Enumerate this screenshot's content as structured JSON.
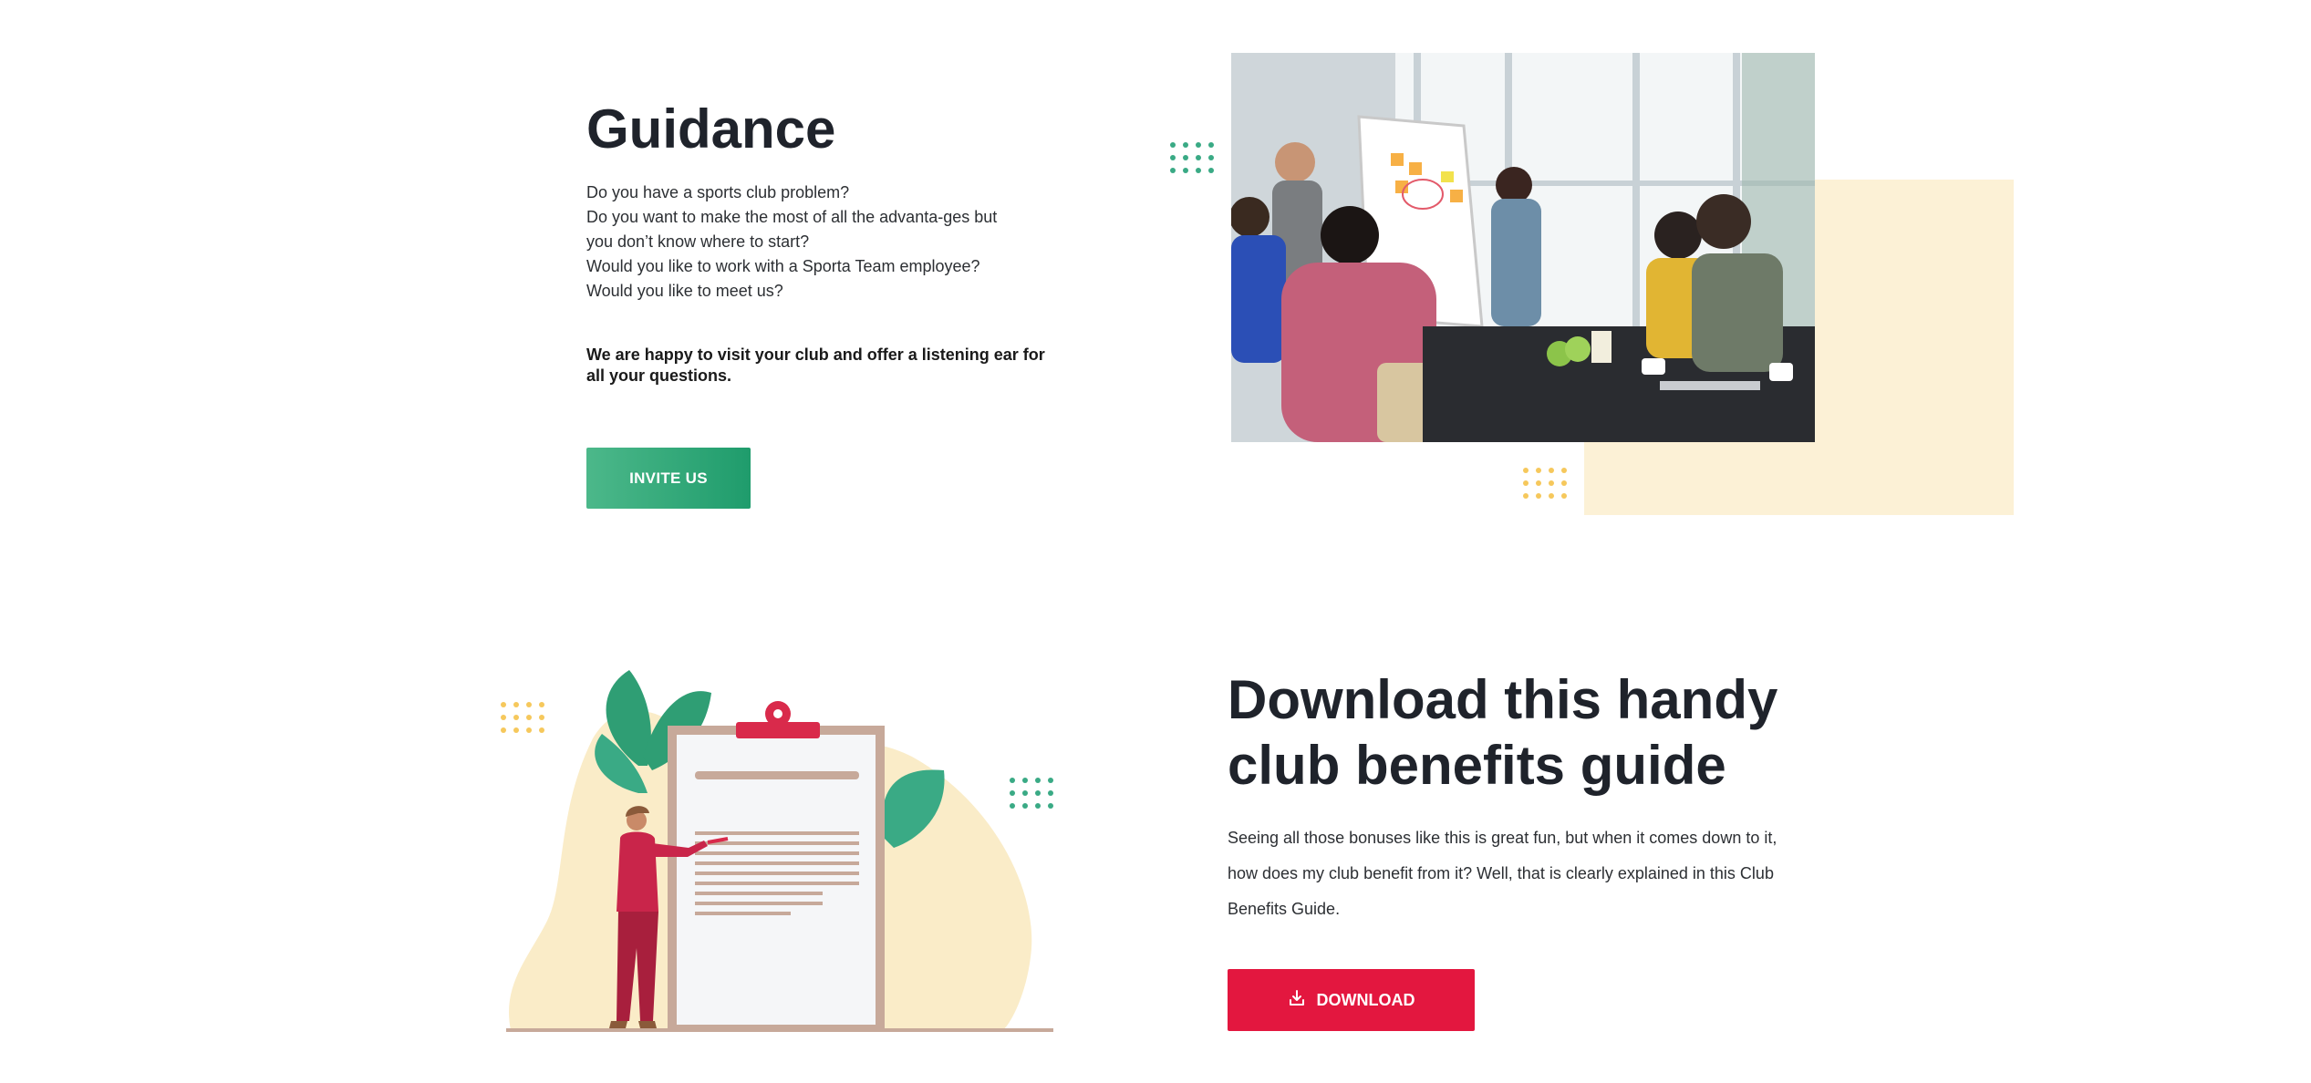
{
  "guidance": {
    "title": "Guidance",
    "lines": [
      "Do you have a sports club problem?",
      "Do you want to make the most of all the advanta-ges but",
      "you don’t know where to start?",
      "Would you like to work with a Sporta Team employee?",
      "Would you like to meet us?"
    ],
    "bold_text": "We are happy to visit your club and offer a listening ear for all your questions.",
    "button_label": "INVITE US"
  },
  "download": {
    "title": "Download this handy club benefits guide",
    "description": "Seeing all those bonuses like this is great fun, but when it comes down to it, how does my club benefit from it? Well, that is clearly explained in this Club Benefits Guide.",
    "button_label": "DOWNLOAD",
    "button_icon": "download-icon"
  },
  "colors": {
    "green_accent": "#3aaa85",
    "yellow_accent": "#f6c85c",
    "pale_yellow": "#fcf1d6",
    "download_red": "#e3173f"
  }
}
